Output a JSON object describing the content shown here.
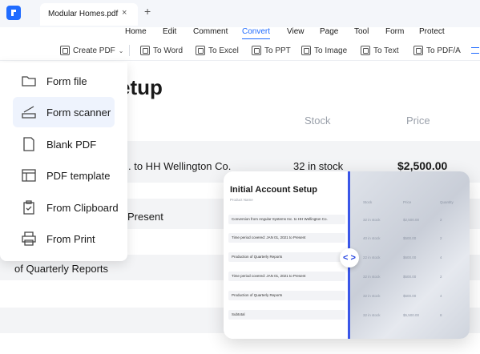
{
  "tab": {
    "title": "Modular Homes.pdf",
    "close": "×",
    "add": "+"
  },
  "menu": [
    "Home",
    "Edit",
    "Comment",
    "Convert",
    "View",
    "Page",
    "Tool",
    "Form",
    "Protect"
  ],
  "menu_active": "Convert",
  "toolbar": {
    "create_pdf": "Create PDF",
    "to_word": "To Word",
    "to_excel": "To Excel",
    "to_ppt": "To PPT",
    "to_image": "To Image",
    "to_text": "To Text",
    "to_pdfa": "To PDF/A"
  },
  "dropdown": [
    {
      "label": "Form file",
      "icon": "folder-icon"
    },
    {
      "label": "Form scanner",
      "icon": "scanner-icon"
    },
    {
      "label": "Blank PDF",
      "icon": "blank-page-icon"
    },
    {
      "label": "PDF template",
      "icon": "template-icon"
    },
    {
      "label": "From Clipboard",
      "icon": "clipboard-icon"
    },
    {
      "label": "From Print",
      "icon": "printer-icon"
    }
  ],
  "document": {
    "title_fragment": "etup",
    "col_stock": "Stock",
    "col_price": "Price",
    "row1_text": ". to HH Wellington Co.",
    "row1_stock": "32 in stock",
    "row1_price": "$2,500.00",
    "row2_text": "Present",
    "row3_text": "of Quarterly Reports"
  },
  "card": {
    "title": "Initial Account Setup",
    "subtitle": "Product Name",
    "rows": [
      "Conversion from Angular Systems Inc. to HH Wellington Co.",
      "Time period covered: JAN 01, 2021 to Present",
      "Production of Quarterly Reports",
      "Time period covered: JAN 01, 2021 to Present",
      "Production of Quarterly Reports",
      "Subtotal"
    ],
    "right_cols": [
      "Stock",
      "Price",
      "Quantity"
    ],
    "right_rows": [
      [
        "32 in stock",
        "$2,500.00",
        "2"
      ],
      [
        "40 in stock",
        "$500.00",
        "2"
      ],
      [
        "22 in stock",
        "$600.00",
        "4"
      ],
      [
        "32 in stock",
        "$500.00",
        "2"
      ],
      [
        "32 in stock",
        "$600.00",
        "4"
      ],
      [
        "32 in stock",
        "$5,500.00",
        "8"
      ]
    ],
    "swap": "< >"
  },
  "colors": {
    "accent": "#1f6bff",
    "divider": "#3a56e8"
  }
}
